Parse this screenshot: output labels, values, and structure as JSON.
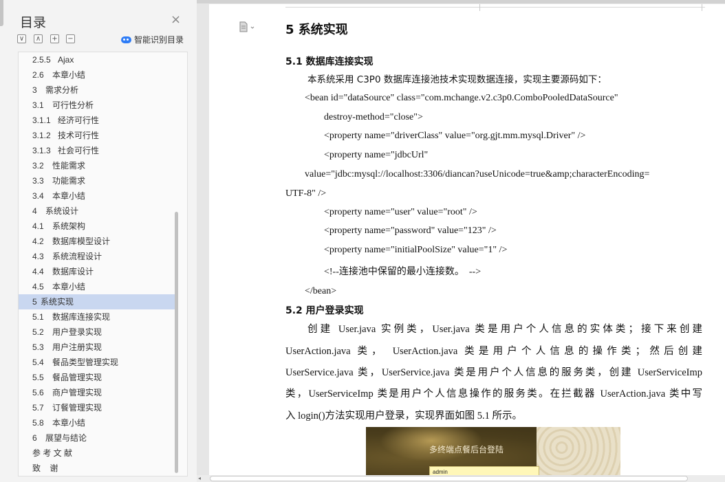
{
  "toc": {
    "title": "目录",
    "smart_toc_label": "智能识别目录",
    "toolbar": {
      "collapse": "∨",
      "expand": "∧",
      "add": "+",
      "remove": "−"
    },
    "items": [
      {
        "num": "2.5.5",
        "label": "Ajax",
        "level": 3
      },
      {
        "num": "2.6",
        "label": "本章小结",
        "level": 2
      },
      {
        "num": "3",
        "label": "需求分析",
        "level": 1
      },
      {
        "num": "3.1",
        "label": "可行性分析",
        "level": 2
      },
      {
        "num": "3.1.1",
        "label": "经济可行性",
        "level": 3
      },
      {
        "num": "3.1.2",
        "label": "技术可行性",
        "level": 3
      },
      {
        "num": "3.1.3",
        "label": "社会可行性",
        "level": 3
      },
      {
        "num": "3.2",
        "label": "性能需求",
        "level": 2
      },
      {
        "num": "3.3",
        "label": "功能需求",
        "level": 2
      },
      {
        "num": "3.4",
        "label": "本章小结",
        "level": 2
      },
      {
        "num": "4",
        "label": "系统设计",
        "level": 1
      },
      {
        "num": "4.1",
        "label": "系统架构",
        "level": 2
      },
      {
        "num": "4.2",
        "label": "数据库模型设计",
        "level": 2
      },
      {
        "num": "4.3",
        "label": "系统流程设计",
        "level": 2
      },
      {
        "num": "4.4",
        "label": "数据库设计",
        "level": 2
      },
      {
        "num": "4.5",
        "label": "本章小结",
        "level": 2
      },
      {
        "num": "5",
        "label": "系统实现",
        "level": 1,
        "active": true
      },
      {
        "num": "5.1",
        "label": "数据库连接实现",
        "level": 2
      },
      {
        "num": "5.2",
        "label": "用户登录实现",
        "level": 2
      },
      {
        "num": "5.3",
        "label": "用户注册实现",
        "level": 2
      },
      {
        "num": "5.4",
        "label": "餐品类型管理实现",
        "level": 2
      },
      {
        "num": "5.5",
        "label": "餐品管理实现",
        "level": 2
      },
      {
        "num": "5.6",
        "label": "商户管理实现",
        "level": 2
      },
      {
        "num": "5.7",
        "label": "订餐管理实现",
        "level": 2
      },
      {
        "num": "5.8",
        "label": "本章小结",
        "level": 2
      },
      {
        "num": "6",
        "label": "展望与结论",
        "level": 1
      },
      {
        "num": "",
        "label": "参 考 文 献",
        "level": 1
      },
      {
        "num": "",
        "label": "致    谢",
        "level": 1
      }
    ]
  },
  "doc": {
    "h1": "5  系统实现",
    "s51_title": "5.1   数据库连接实现",
    "s51_intro": "本系统采用 C3P0 数据库连接池技术实现数据连接，实现主要源码如下：",
    "code": [
      "<bean id=\"dataSource\" class=\"com.mchange.v2.c3p0.ComboPooledDataSource\"",
      "destroy-method=\"close\">",
      "<property name=\"driverClass\" value=\"org.gjt.mm.mysql.Driver\" />",
      "<property name=\"jdbcUrl\"",
      "value=\"jdbc:mysql://localhost:3306/diancan?useUnicode=true&amp;characterEncoding=",
      "UTF-8\" />",
      "<property name=\"user\" value=\"root\" />",
      "<property name=\"password\" value=\"123\" />",
      "<property name=\"initialPoolSize\" value=\"1\" />",
      "<!--连接池中保留的最小连接数。  -->",
      "</bean>"
    ],
    "s52_title": "5.2   用户登录实现",
    "s52_para": [
      "创建 User.java 实例类，User.java 类是用户个人信息的实体类；接下来创建",
      "UserAction.java 类， UserAction.java 类是用户个人信息的操作类；然后创建",
      "UserService.java 类，UserService.java 类是用户个人信息的服务类，创建 UserServiceImp",
      "类，UserServiceImp 类是用户个人信息操作的服务类。在拦截器 UserAction.java 类中写",
      "入 login()方法实现用户登录，实现界面如图 5.1 所示。"
    ],
    "figure": {
      "title": "多终端点餐后台登陆",
      "username_value": "admin"
    }
  }
}
